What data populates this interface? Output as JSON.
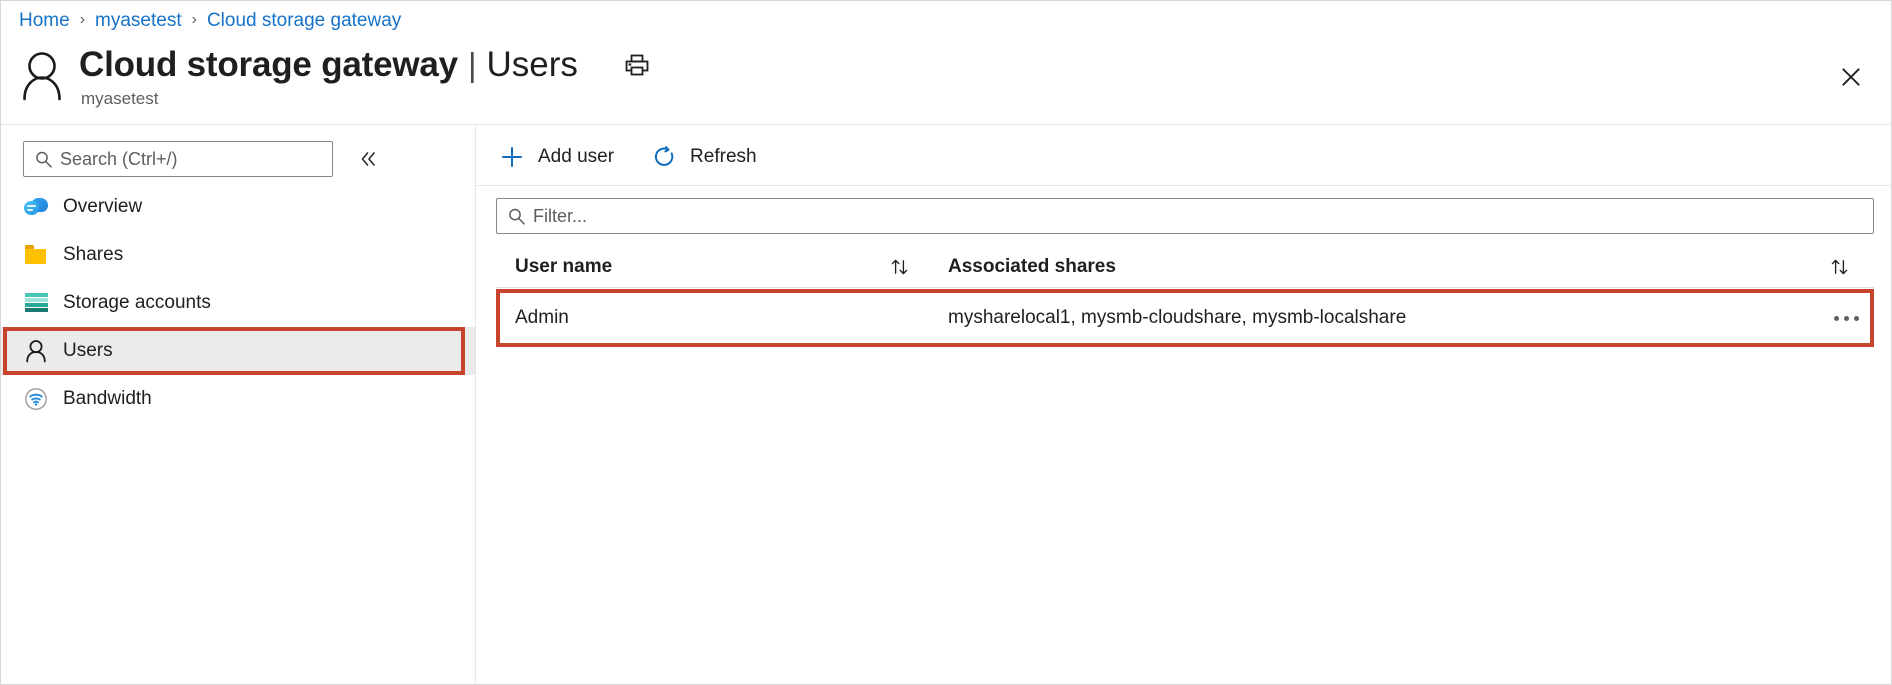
{
  "breadcrumb": {
    "items": [
      {
        "label": "Home"
      },
      {
        "label": "myasetest"
      },
      {
        "label": "Cloud storage gateway"
      }
    ],
    "separator": "›"
  },
  "header": {
    "avatar_icon": "person-icon",
    "title": "Cloud storage gateway",
    "title_divider": "|",
    "subpage": "Users",
    "subtitle": "myasetest",
    "print_icon": "printer-icon",
    "close_icon": "close-icon"
  },
  "sidebar": {
    "search": {
      "placeholder": "Search (Ctrl+/)",
      "value": "",
      "icon": "search-icon"
    },
    "collapse_icon": "chevron-double-left-icon",
    "items": [
      {
        "label": "Overview",
        "icon": "cloud-icon",
        "selected": false
      },
      {
        "label": "Shares",
        "icon": "folder-icon",
        "selected": false
      },
      {
        "label": "Storage accounts",
        "icon": "storage-accounts-icon",
        "selected": false
      },
      {
        "label": "Users",
        "icon": "person-icon",
        "selected": true,
        "highlighted": true
      },
      {
        "label": "Bandwidth",
        "icon": "bandwidth-wifi-icon",
        "selected": false
      }
    ]
  },
  "main": {
    "toolbar": [
      {
        "label": "Add user",
        "icon": "plus-icon"
      },
      {
        "label": "Refresh",
        "icon": "refresh-icon"
      }
    ],
    "filter": {
      "placeholder": "Filter...",
      "value": "",
      "icon": "search-icon"
    },
    "table": {
      "columns": [
        {
          "label": "User name",
          "sort_icon": "sort-updown-icon"
        },
        {
          "label": "Associated shares",
          "sort_icon": "sort-updown-icon"
        }
      ],
      "rows": [
        {
          "user_name": "Admin",
          "associated_shares": "mysharelocal1, mysmb-cloudshare, mysmb-localshare",
          "more_icon": "ellipsis-icon",
          "highlighted": true
        }
      ]
    }
  },
  "colors": {
    "link": "#1673c8",
    "accent": "#0f6cbd",
    "highlight_box": "#c8432c",
    "selected_row_bg": "#ebebeb",
    "text": "#201f1e",
    "muted_text": "#605e5c"
  }
}
